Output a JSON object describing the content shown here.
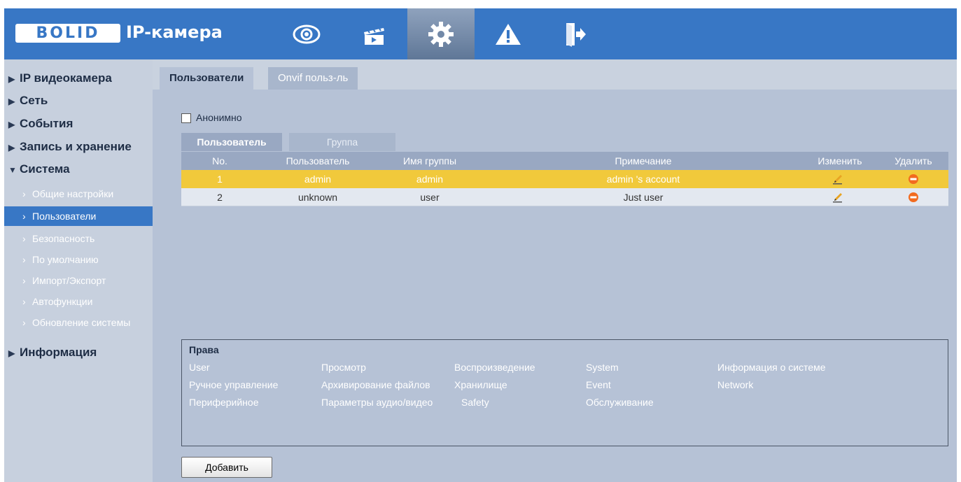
{
  "header": {
    "logo_text": "BOLID",
    "app_title": "IP-камера",
    "nav": [
      {
        "icon": "eye-icon",
        "name": "live-view"
      },
      {
        "icon": "clapperboard-icon",
        "name": "playback"
      },
      {
        "icon": "gear-icon",
        "name": "settings",
        "active": true
      },
      {
        "icon": "warning-icon",
        "name": "alarm"
      },
      {
        "icon": "logout-icon",
        "name": "logout"
      }
    ]
  },
  "sidebar": {
    "top": [
      {
        "label": "IP видеокамера",
        "expanded": false
      },
      {
        "label": "Сеть",
        "expanded": false
      },
      {
        "label": "События",
        "expanded": false
      },
      {
        "label": "Запись и хранение",
        "expanded": false
      },
      {
        "label": "Система",
        "expanded": true
      },
      {
        "label": "Информация",
        "expanded": false
      }
    ],
    "system_items": [
      {
        "label": "Общие настройки"
      },
      {
        "label": "Пользователи",
        "active": true
      },
      {
        "label": "Безопасность"
      },
      {
        "label": "По умолчанию"
      },
      {
        "label": "Импорт/Экспорт"
      },
      {
        "label": "Автофункции"
      },
      {
        "label": "Обновление системы"
      }
    ]
  },
  "tabs": [
    "Пользователи",
    "Onvif польз-ль"
  ],
  "anonymous_label": "Анонимно",
  "subtabs": [
    "Пользователь",
    "Группа"
  ],
  "table": {
    "headers": [
      "No.",
      "Пользователь",
      "Имя группы",
      "Примечание",
      "Изменить",
      "Удалить"
    ],
    "rows": [
      {
        "no": "1",
        "user": "admin",
        "group": "admin",
        "note": "admin 's account",
        "selected": true
      },
      {
        "no": "2",
        "user": "unknown",
        "group": "user",
        "note": "Just user",
        "selected": false
      }
    ]
  },
  "rights": {
    "title": "Права",
    "columns": [
      [
        "User",
        "Ручное управление",
        "Периферийное"
      ],
      [
        "Просмотр",
        "Архивирование файлов",
        "Параметры аудио/видео"
      ],
      [
        "Воспроизведение",
        "Хранилище",
        "Safety"
      ],
      [
        "System",
        "Event",
        "Обслуживание"
      ],
      [
        "Информация о системе",
        "Network"
      ]
    ]
  },
  "add_button": "Добавить",
  "colors": {
    "header_blue": "#3877c5",
    "content_bg": "#b6c2d6",
    "selected_row": "#f1c93b",
    "delete_orange": "#f26b1f"
  }
}
